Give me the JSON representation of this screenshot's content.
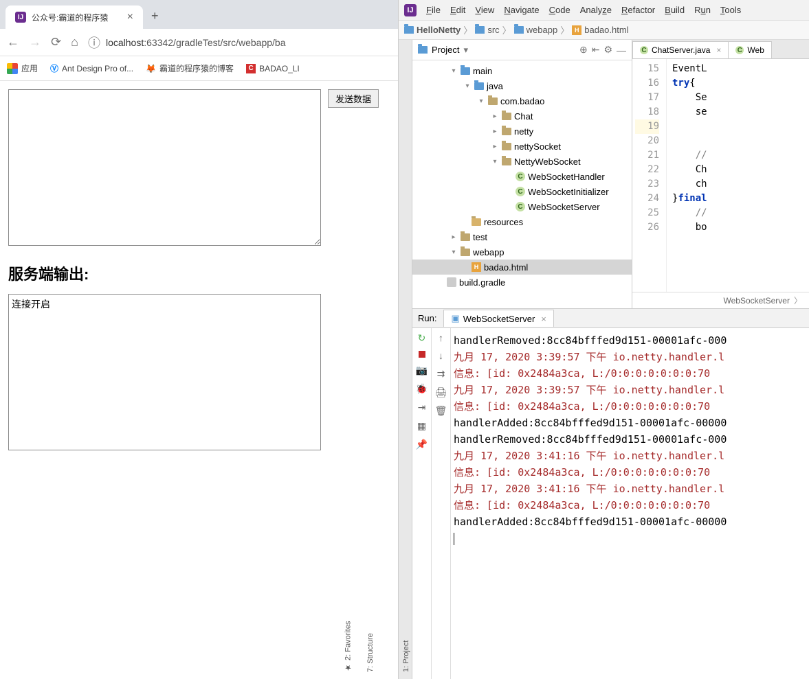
{
  "browser": {
    "tab_title": "公众号:霸道的程序猿",
    "url_prefix": "localhost",
    "url_rest": ":63342/gradleTest/src/webapp/ba",
    "bookmarks": {
      "apps": "应用",
      "ant": "Ant Design Pro of...",
      "blog": "霸道的程序猿的博客",
      "badao": "BADAO_LI"
    },
    "page": {
      "send_btn": "发送数据",
      "output_title": "服务端输出:",
      "output_text": "连接开启"
    }
  },
  "ide": {
    "menus": [
      "File",
      "Edit",
      "View",
      "Navigate",
      "Code",
      "Analyze",
      "Refactor",
      "Build",
      "Run",
      "Tools"
    ],
    "breadcrumbs": [
      "HelloNetty",
      "src",
      "webapp",
      "badao.html"
    ],
    "project_label": "Project",
    "tree": {
      "main": "main",
      "java": "java",
      "pkg": "com.badao",
      "chat": "Chat",
      "netty": "netty",
      "nettySocket": "nettySocket",
      "nettyWebSocket": "NettyWebSocket",
      "wsHandler": "WebSocketHandler",
      "wsInit": "WebSocketInitializer",
      "wsServer": "WebSocketServer",
      "resources": "resources",
      "test": "test",
      "webapp": "webapp",
      "badao_html": "badao.html",
      "build_gradle": "build.gradle"
    },
    "editor": {
      "tab1": "ChatServer.java",
      "tab2": "Web",
      "gutter": [
        "15",
        "16",
        "17",
        "18",
        "19",
        "20",
        "21",
        "22",
        "23",
        "24",
        "25",
        "26"
      ],
      "lines": {
        "l15": "EventL",
        "l16a": "try",
        "l16b": "{",
        "l17": "    Se",
        "l18": "    se",
        "l19": "",
        "l20": "",
        "l21": "    //",
        "l22": "    Ch",
        "l23": "    ch",
        "l24a": "}",
        "l24b": "final",
        "l25": "    //",
        "l26": "    bo"
      },
      "crumb_bottom": "WebSocketServer"
    },
    "run": {
      "label": "Run:",
      "tab": "WebSocketServer",
      "console": [
        {
          "cls": "",
          "t": "handlerRemoved:8cc84bfffed9d151-00001afc-000"
        },
        {
          "cls": "red",
          "t": "九月 17, 2020 3:39:57 下午 io.netty.handler.l"
        },
        {
          "cls": "red",
          "t": "信息: [id: 0x2484a3ca, L:/0:0:0:0:0:0:0:70"
        },
        {
          "cls": "red",
          "t": "九月 17, 2020 3:39:57 下午 io.netty.handler.l"
        },
        {
          "cls": "red",
          "t": "信息: [id: 0x2484a3ca, L:/0:0:0:0:0:0:0:70"
        },
        {
          "cls": "",
          "t": "handlerAdded:8cc84bfffed9d151-00001afc-00000"
        },
        {
          "cls": "",
          "t": "handlerRemoved:8cc84bfffed9d151-00001afc-000"
        },
        {
          "cls": "red",
          "t": "九月 17, 2020 3:41:16 下午 io.netty.handler.l"
        },
        {
          "cls": "red",
          "t": "信息: [id: 0x2484a3ca, L:/0:0:0:0:0:0:0:70"
        },
        {
          "cls": "red",
          "t": "九月 17, 2020 3:41:16 下午 io.netty.handler.l"
        },
        {
          "cls": "red",
          "t": "信息: [id: 0x2484a3ca, L:/0:0:0:0:0:0:0:70"
        },
        {
          "cls": "",
          "t": "handlerAdded:8cc84bfffed9d151-00001afc-00000"
        }
      ]
    },
    "side": {
      "project": "1: Project",
      "structure": "7: Structure",
      "favorites": "2: Favorites"
    }
  }
}
